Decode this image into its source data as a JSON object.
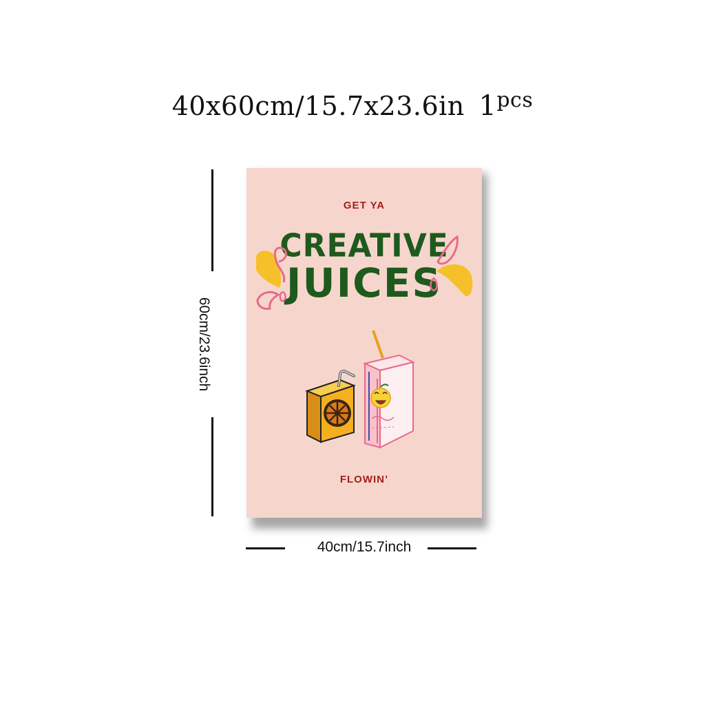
{
  "header": {
    "size": "40x60cm/15.7x23.6in",
    "qty_number": "1",
    "qty_unit": "pcs"
  },
  "poster": {
    "top_text": "GET YA",
    "title_line1": "CREATIVE",
    "title_line2": "JUICES",
    "bottom_text": "FLOWIN’",
    "colors": {
      "background": "#f6d6cc",
      "title_green": "#1e5a1e",
      "accent_red": "#a3201c",
      "yellow": "#f5c02a",
      "pink": "#e8698a"
    }
  },
  "dimensions": {
    "height_label": "60cm/23.6inch",
    "width_label": "40cm/15.7inch"
  }
}
